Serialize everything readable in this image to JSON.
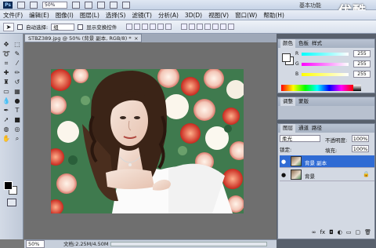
{
  "appbar": {
    "logo": "Ps",
    "zoom": "50%",
    "workspace": "基本功能",
    "watermark": "优酷"
  },
  "menu": [
    "文件(F)",
    "编辑(E)",
    "图像(I)",
    "图层(L)",
    "选择(S)",
    "滤镜(T)",
    "分析(A)",
    "3D(D)",
    "视图(V)",
    "窗口(W)",
    "帮助(H)"
  ],
  "options": {
    "auto_select_label": "自动选择:",
    "auto_select_value": "组",
    "show_transform_label": "显示变换控件"
  },
  "document": {
    "tab_title": "STBZ389.jpg @ 50% (背景 副本, RGB/8) *",
    "close": "×"
  },
  "status": {
    "zoom": "50%",
    "doc_size": "文档:2.25M/4.50M"
  },
  "color_panel": {
    "tabs": [
      "颜色",
      "色板",
      "样式"
    ],
    "r": {
      "label": "R",
      "value": "255"
    },
    "g": {
      "label": "G",
      "value": "255"
    },
    "b": {
      "label": "B",
      "value": "255"
    }
  },
  "mid_panel": {
    "tabs": [
      "调整",
      "蒙版"
    ]
  },
  "layers_panel": {
    "tabs": [
      "图层",
      "通道",
      "路径"
    ],
    "blend_mode": "柔光",
    "opacity_label": "不透明度:",
    "opacity_value": "100%",
    "lock_label": "锁定:",
    "fill_label": "填充:",
    "fill_value": "100%",
    "layers": [
      {
        "name": "背景 副本",
        "selected": true
      },
      {
        "name": "背景",
        "selected": false,
        "locked": true
      }
    ]
  },
  "colors": {
    "selection": "#2f6bd4",
    "panel_bg": "#d3d9e3",
    "canvas_bg": "#6f6f6f"
  }
}
